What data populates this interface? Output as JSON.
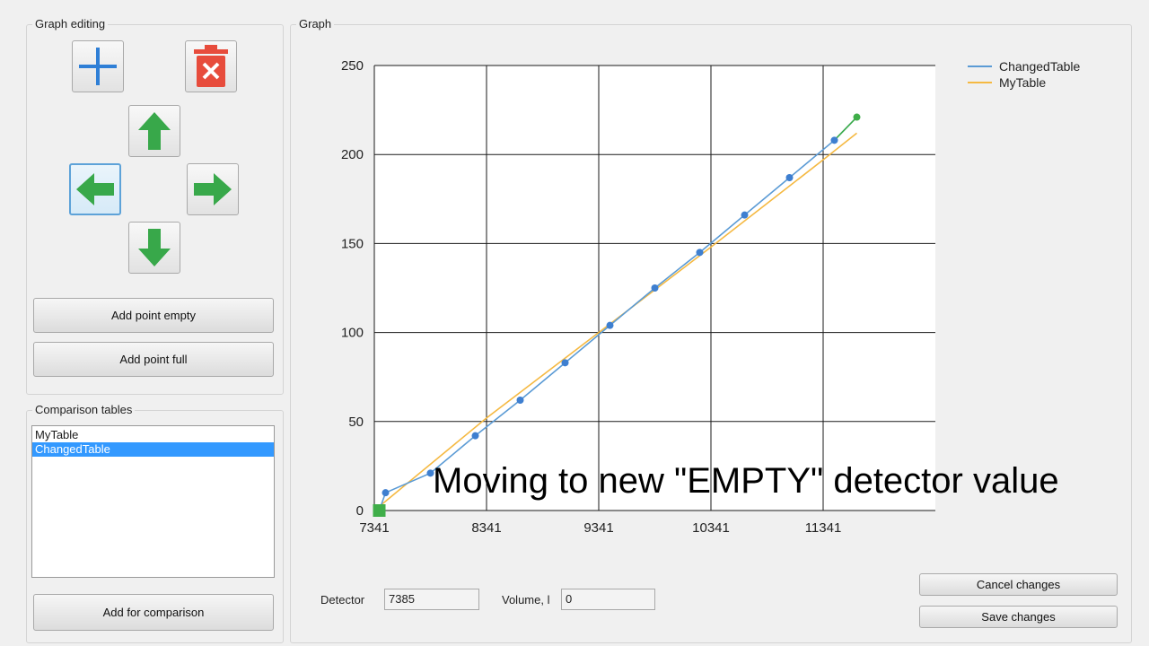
{
  "graph_editing": {
    "title": "Graph editing",
    "icons": {
      "add": "plus-icon",
      "delete": "trash-icon",
      "up": "arrow-up-icon",
      "left": "arrow-left-icon",
      "right": "arrow-right-icon",
      "down": "arrow-down-icon"
    },
    "add_point_empty": "Add point empty",
    "add_point_full": "Add point full"
  },
  "comparison": {
    "title": "Comparison tables",
    "items": [
      {
        "label": "MyTable",
        "selected": false
      },
      {
        "label": "ChangedTable",
        "selected": true
      }
    ],
    "add_button": "Add for comparison"
  },
  "graph": {
    "title": "Graph",
    "detector_label": "Detector",
    "detector_value": "7385",
    "volume_label": "Volume, l",
    "volume_value": "0",
    "cancel_button": "Cancel changes",
    "save_button": "Save changes"
  },
  "overlay_caption": "Moving to new \"EMPTY\" detector value",
  "colors": {
    "changed": "#5b9bd5",
    "mytable": "#f5b942",
    "point": "#3e7fd0",
    "highlight": "#3fae49",
    "selection": "#3399ff"
  },
  "chart_data": {
    "type": "line",
    "xlim": [
      7341,
      12341
    ],
    "ylim": [
      0,
      250
    ],
    "xticks": [
      "7341",
      "8341",
      "9341",
      "10341",
      "11341"
    ],
    "yticks": [
      "0",
      "50",
      "100",
      "150",
      "200",
      "250"
    ],
    "grid": true,
    "legend_position": "top-right",
    "series": [
      {
        "name": "ChangedTable",
        "color": "#5b9bd5",
        "markers": true,
        "x": [
          7385,
          7441,
          7841,
          8241,
          8641,
          9041,
          9441,
          9841,
          10241,
          10641,
          11041,
          11441,
          11641
        ],
        "y": [
          0,
          10,
          21,
          42,
          62,
          83,
          104,
          125,
          145,
          166,
          187,
          208,
          221
        ]
      },
      {
        "name": "MyTable",
        "color": "#f5b942",
        "markers": false,
        "x": [
          7341,
          8341,
          9341,
          10341,
          11341,
          11641
        ],
        "y": [
          0,
          52,
          100,
          148,
          197,
          212
        ]
      }
    ]
  }
}
